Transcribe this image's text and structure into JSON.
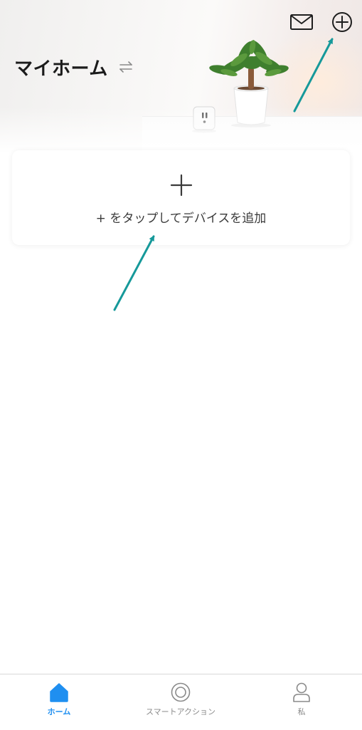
{
  "header": {
    "title": "マイホーム",
    "switch_icon": "swap-arrows-icon",
    "mail_icon": "mail-icon",
    "add_icon": "add-circle-icon"
  },
  "add_card": {
    "plus_icon": "plus-icon",
    "hint": "+ をタップしてデバイスを追加"
  },
  "bottom_nav": {
    "items": [
      {
        "label": "ホーム",
        "icon": "home-icon",
        "active": true
      },
      {
        "label": "スマートアクション",
        "icon": "smart-action-icon",
        "active": false
      },
      {
        "label": "私",
        "icon": "profile-icon",
        "active": false
      }
    ]
  },
  "colors": {
    "accent": "#1f8ff0",
    "annotation_arrow": "#16999a",
    "inactive": "#8a8a8a"
  }
}
